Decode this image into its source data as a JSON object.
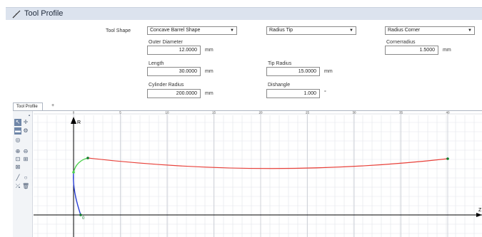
{
  "window": {
    "title": "Tool Profile"
  },
  "form": {
    "tool_shape_label": "Tool Shape",
    "shape_select": "Concave Barrel Shape",
    "tip_select": "Radius Tip",
    "corner_select": "Radius Corner",
    "outer_diameter": {
      "label": "Outer Diameter",
      "value": "12.0000",
      "unit": "mm"
    },
    "length": {
      "label": "Length",
      "value": "30.0000",
      "unit": "mm"
    },
    "cylinder_radius": {
      "label": "Cylinder Radius",
      "value": "200.0000",
      "unit": "mm"
    },
    "tip_radius": {
      "label": "Tip Radius",
      "value": "15.0000",
      "unit": "mm"
    },
    "dishangle": {
      "label": "Dishangle",
      "value": "1.000",
      "unit": "°"
    },
    "cornerradius": {
      "label": "Cornerradius",
      "value": "1.5000",
      "unit": "mm"
    }
  },
  "tabs": {
    "active": "Tool Profile",
    "add": "+"
  },
  "toolbar": {
    "icons": [
      "select-tool-icon",
      "pan-icon",
      "fill-icon",
      "settings-icon",
      "target-icon",
      "zoom-in-icon",
      "zoom-out-icon",
      "zoom-window-icon",
      "zoom-fit-icon",
      "zoom-all-icon",
      "line-icon",
      "circle-icon",
      "snap-icon",
      "delete-icon"
    ]
  },
  "viewport": {
    "axis_labels": {
      "y": "R",
      "x": "Z",
      "origin": "0"
    },
    "x_ticks": [
      "0",
      "5",
      "10",
      "15",
      "20",
      "25",
      "30",
      "35",
      "40"
    ],
    "colors": {
      "profile_main": "#e8413a",
      "profile_corner": "#4bd14b",
      "profile_tip": "#2a3fd4",
      "node": "#0f7a2a",
      "grid": "#e2e5ea",
      "axis": "#000000"
    }
  }
}
